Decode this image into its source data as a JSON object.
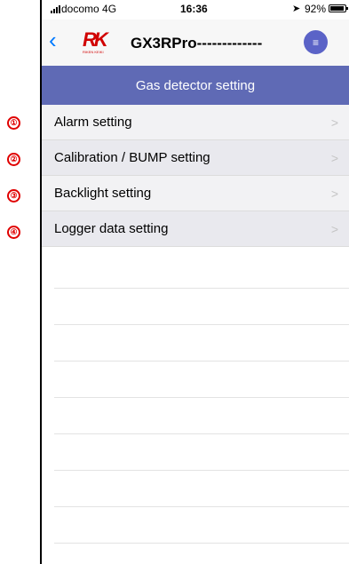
{
  "status_bar": {
    "carrier": "docomo  4G",
    "time": "16:36",
    "battery": "92%",
    "battery_level": 0.92
  },
  "nav": {
    "back_icon": "chevron-left-icon",
    "logo_mark": "RK",
    "logo_sub": "RIKEN KEIKI",
    "device_name": "GX3RPro-------------",
    "menu_symbol": "≡"
  },
  "header": {
    "title": "Gas detector setting"
  },
  "markers": [
    "①",
    "②",
    "③",
    "④"
  ],
  "menu": {
    "items": [
      {
        "label": "Alarm setting"
      },
      {
        "label": "Calibration / BUMP setting"
      },
      {
        "label": "Backlight setting"
      },
      {
        "label": "Logger data setting"
      }
    ]
  },
  "colors": {
    "accent": "#5f6ab5",
    "menu_button": "#5b63c7",
    "back": "#007aff",
    "marker": "#e00000"
  }
}
